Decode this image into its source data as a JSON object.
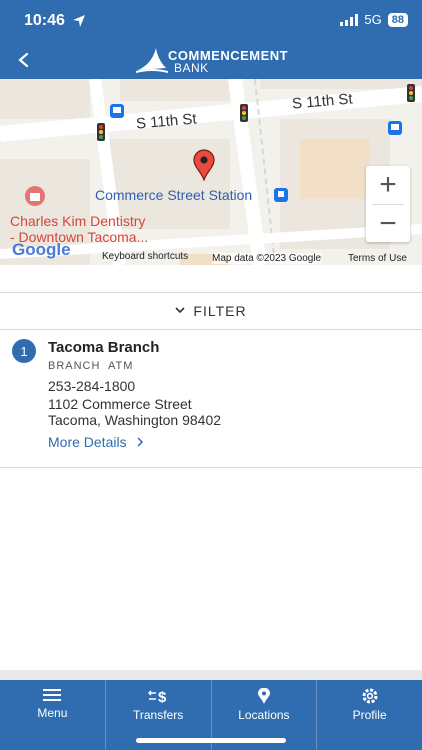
{
  "status": {
    "time": "10:46",
    "network": "5G",
    "battery": "88"
  },
  "header": {
    "bank_line1": "COMMENCEMENT",
    "bank_line2": "BANK"
  },
  "map": {
    "streets": {
      "top_right": "S 11th St",
      "mid_left": "S 11th St"
    },
    "places": {
      "station": "Commerce Street Station",
      "dentistry_line1": "Charles Kim Dentistry",
      "dentistry_line2": "- Downtown Tacoma..."
    },
    "google": "Google",
    "footer": {
      "shortcuts": "Keyboard shortcuts",
      "mapdata": "Map data ©2023 Google",
      "terms": "Terms of Use"
    },
    "zoom": {
      "plus": "+",
      "minus": "−"
    }
  },
  "filter": {
    "label": "FILTER"
  },
  "results": [
    {
      "index": "1",
      "name": "Tacoma Branch",
      "types": "BRANCH  ATM",
      "phone": "253-284-1800",
      "address_line1": "1102 Commerce Street",
      "address_line2": "Tacoma, Washington 98402",
      "more": "More Details"
    }
  ],
  "nav": {
    "menu": "Menu",
    "transfers": "Transfers",
    "locations": "Locations",
    "profile": "Profile"
  },
  "colors": {
    "brand": "#2f6cb0"
  }
}
